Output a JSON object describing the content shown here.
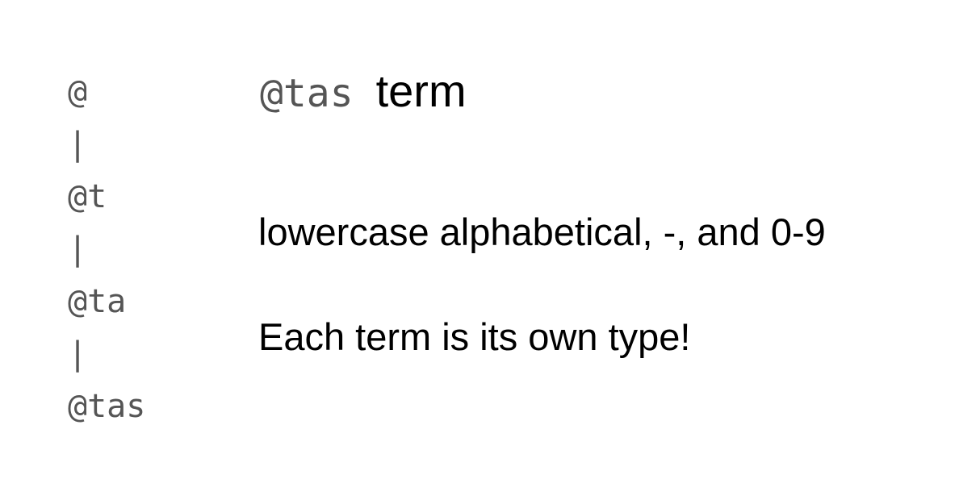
{
  "sequence": [
    "@",
    "|",
    "@t",
    "|",
    "@ta",
    "|",
    "@tas"
  ],
  "heading": {
    "code": "@tas",
    "word": "term"
  },
  "lines": [
    "lowercase alphabetical, -, and 0-9",
    "Each term is its own type!"
  ]
}
